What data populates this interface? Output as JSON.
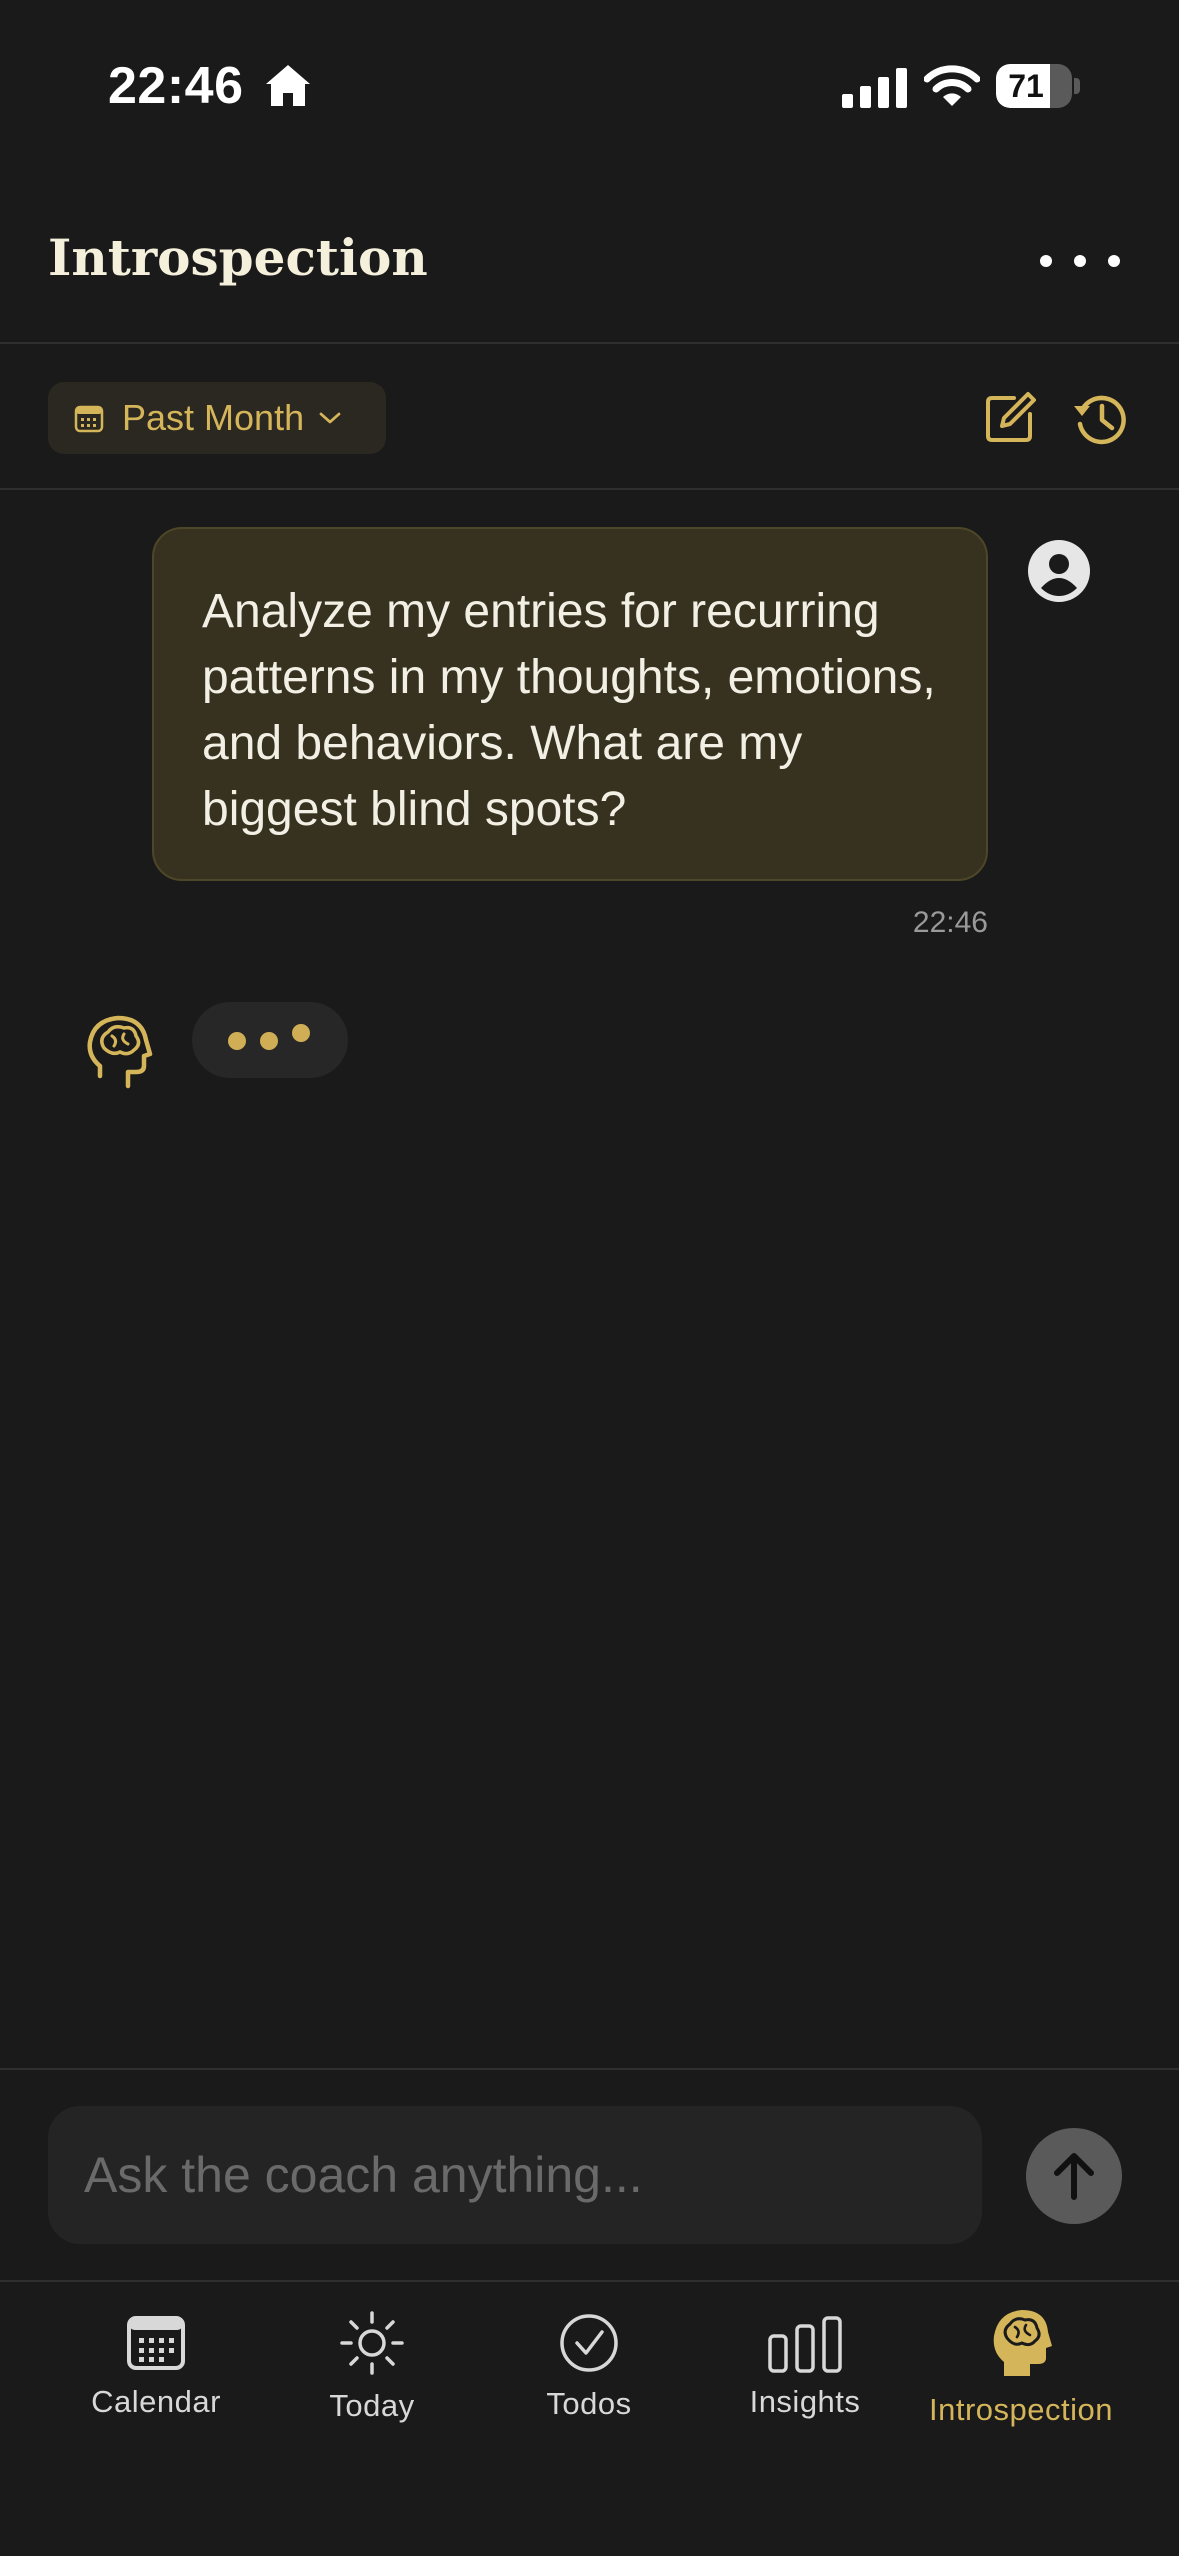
{
  "status_bar": {
    "time": "22:46",
    "battery": "71",
    "battery_level": 0.71
  },
  "header": {
    "title": "Introspection"
  },
  "filter": {
    "range_label": "Past Month"
  },
  "chat": {
    "messages": [
      {
        "role": "user",
        "text": "Analyze my entries for recurring patterns in my thoughts, emotions, and behaviors. What are my biggest blind spots?",
        "time": "22:46"
      }
    ],
    "coach_status": "typing"
  },
  "composer": {
    "placeholder": "Ask the coach anything..."
  },
  "tabs": [
    {
      "label": "Calendar",
      "icon": "calendar-icon",
      "active": false
    },
    {
      "label": "Today",
      "icon": "sun-icon",
      "active": false
    },
    {
      "label": "Todos",
      "icon": "check-circle-icon",
      "active": false
    },
    {
      "label": "Insights",
      "icon": "bar-chart-icon",
      "active": false
    },
    {
      "label": "Introspection",
      "icon": "brain-head-icon",
      "active": true
    }
  ],
  "colors": {
    "accent": "#d5b55a",
    "background": "#1a1a1a",
    "user_bubble": "#37321f"
  }
}
